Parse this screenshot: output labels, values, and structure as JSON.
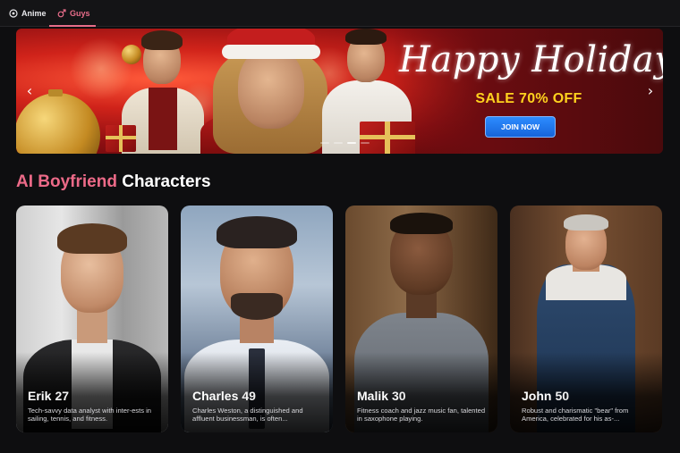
{
  "nav": {
    "tabs": [
      {
        "label": "Anime",
        "icon": "anime-circle-icon",
        "active": false
      },
      {
        "label": "Guys",
        "icon": "male-symbol-icon",
        "active": true
      }
    ],
    "accent_color": "#e86d8a"
  },
  "banner": {
    "title": "Happy Holidays",
    "sale": "SALE 70% OFF",
    "cta": "JOIN NOW",
    "prev_icon": "chevron-left-icon",
    "next_icon": "chevron-right-icon",
    "colors": {
      "sale": "#ffd21e",
      "cta": "#1e74ee"
    }
  },
  "section": {
    "title_accent": "AI Boyfriend",
    "title_rest": "Characters",
    "accent_color": "#ec6a88"
  },
  "characters": [
    {
      "name": "Erik",
      "age": "27",
      "description": "Tech-savvy data analyst with inter-ests in sailing, tennis, and fitness."
    },
    {
      "name": "Charles",
      "age": "49",
      "description": "Charles Weston, a distinguished and affluent businessman, is often..."
    },
    {
      "name": "Malik",
      "age": "30",
      "description": "Fitness coach and jazz music fan, talented in saxophone playing."
    },
    {
      "name": "John",
      "age": "50",
      "description": "Robust and charismatic \"bear\" from America, celebrated for his as-..."
    }
  ]
}
